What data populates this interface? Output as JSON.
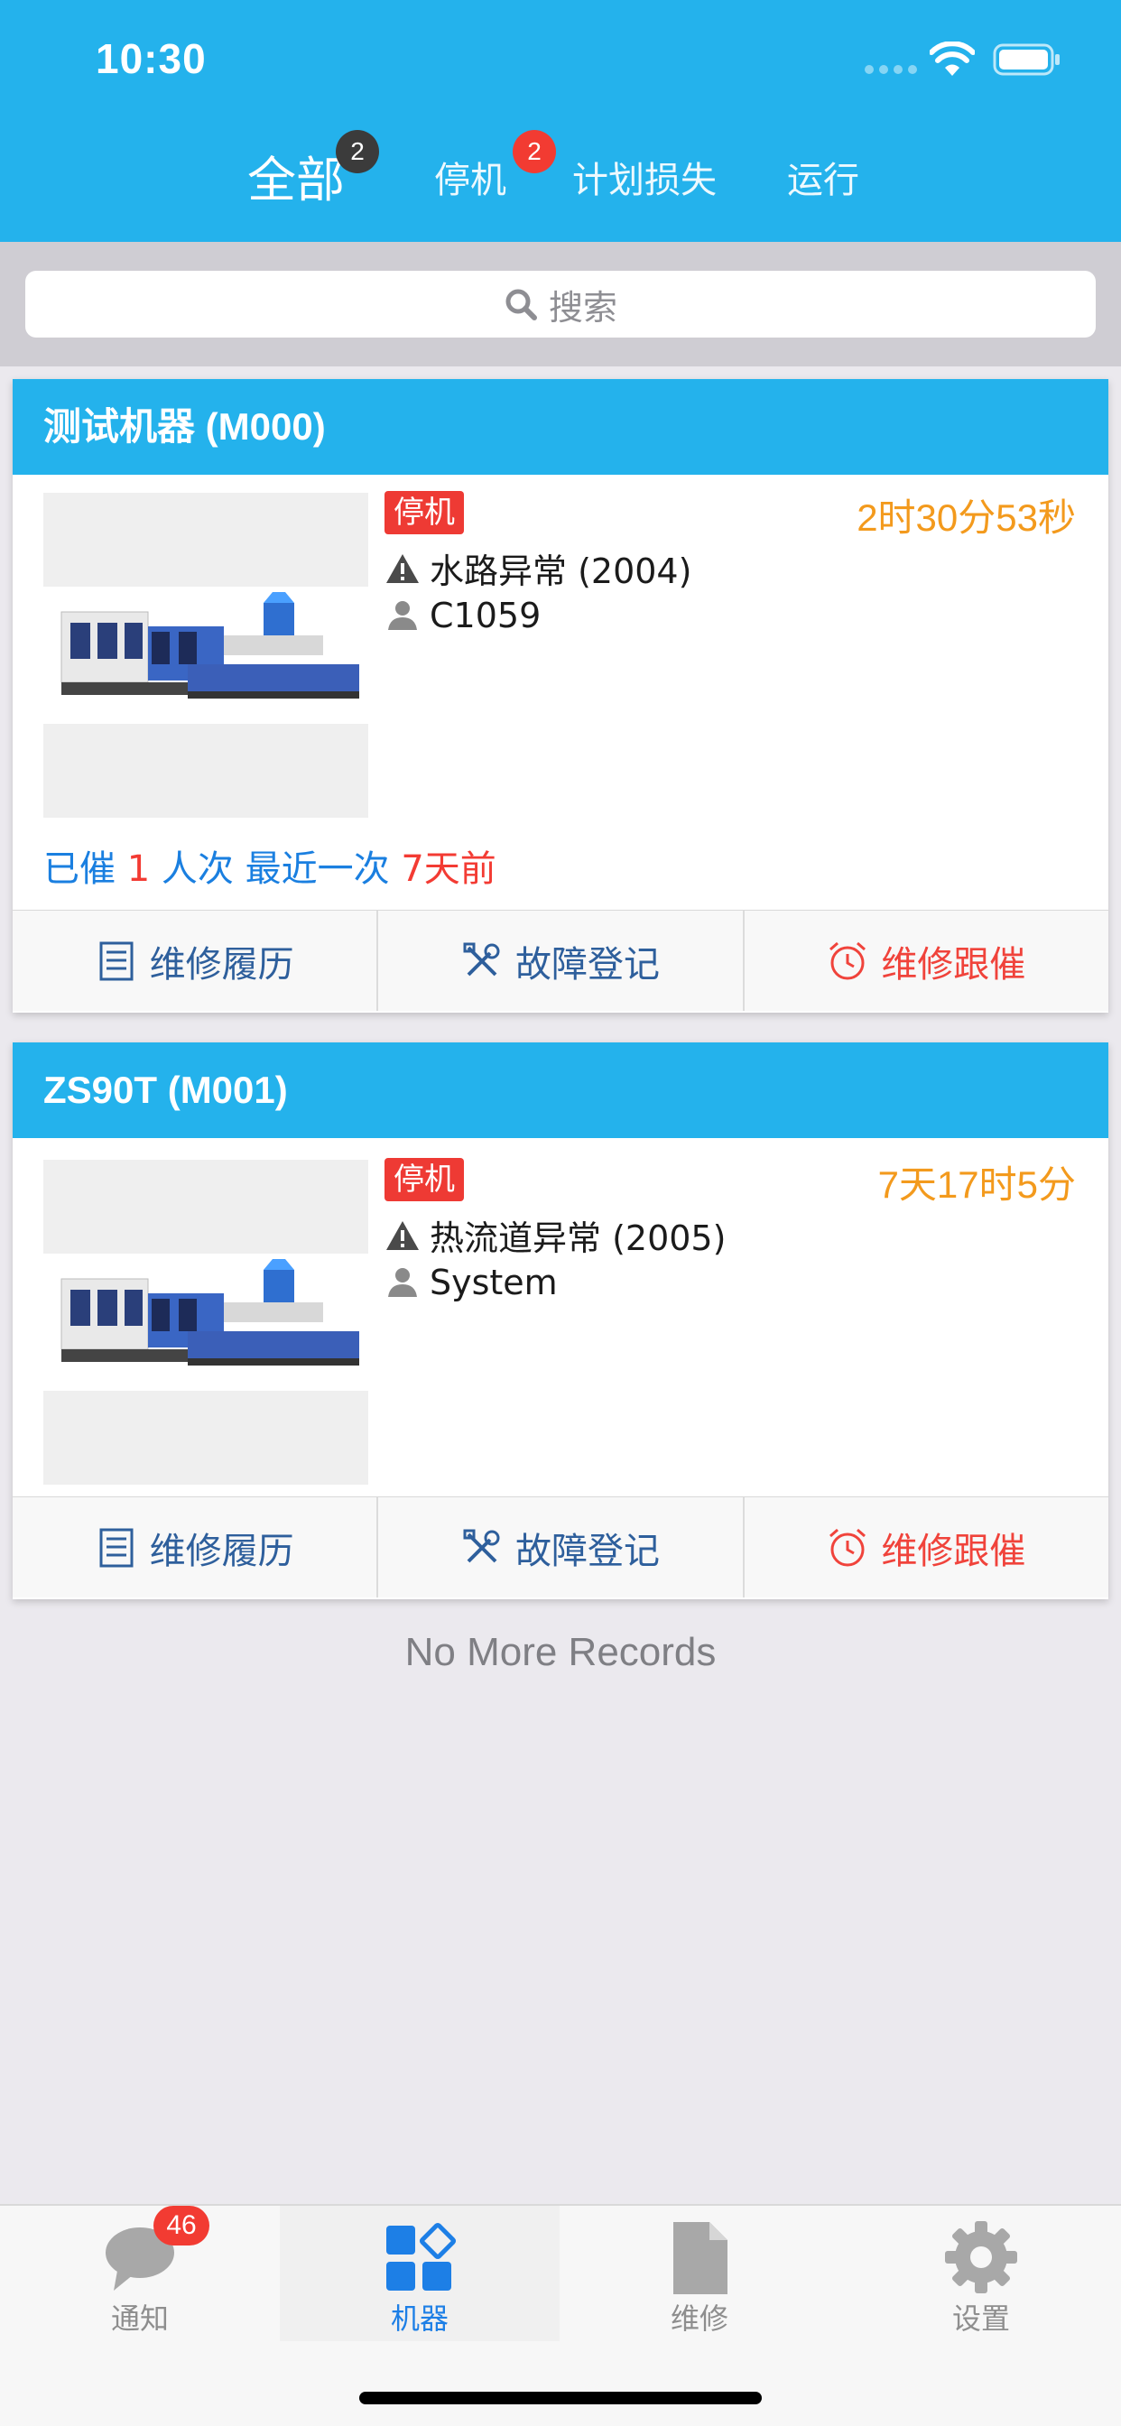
{
  "status_bar": {
    "time": "10:30"
  },
  "tabs": [
    {
      "label": "全部",
      "badge": "2",
      "active": true
    },
    {
      "label": "停机",
      "badge": "2",
      "active": false
    },
    {
      "label": "计划损失",
      "active": false
    },
    {
      "label": "运行",
      "active": false
    }
  ],
  "search": {
    "placeholder": "搜索",
    "icon": "search-icon"
  },
  "machines": [
    {
      "title": "测试机器 (M000)",
      "status": "停机",
      "duration": "2时30分53秒",
      "fault": "水路异常 (2004)",
      "user": "C1059",
      "urge": {
        "prefix": "已催",
        "count": "1",
        "mid": "人次 最近一次",
        "days": "7",
        "suffix": "天前"
      }
    },
    {
      "title": "ZS90T (M001)",
      "status": "停机",
      "duration": "7天17时5分",
      "fault": "热流道异常 (2005)",
      "user": "System"
    }
  ],
  "actions": {
    "history": "维修履历",
    "fault_register": "故障登记",
    "follow_up": "维修跟催"
  },
  "list_footer": "No More Records",
  "bottom_nav": [
    {
      "label": "通知",
      "icon": "chat-bubble-icon",
      "badge": "46"
    },
    {
      "label": "机器",
      "icon": "grid-icon",
      "active": true
    },
    {
      "label": "维修",
      "icon": "document-icon"
    },
    {
      "label": "设置",
      "icon": "gear-icon"
    }
  ],
  "colors": {
    "primary": "#24b2ec",
    "status_red": "#ee3a34",
    "duration_orange": "#f39a1d",
    "link_blue": "#1a7fe0",
    "active_nav": "#1d7fe6"
  }
}
